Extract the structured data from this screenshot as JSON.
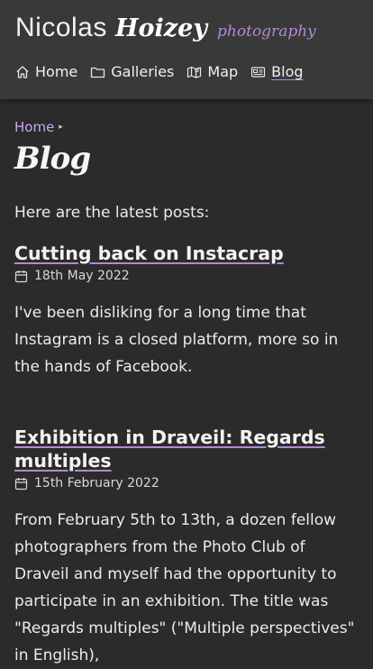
{
  "site": {
    "first_name": "Nicolas",
    "last_name": "Hoizey",
    "subtitle": "photography"
  },
  "nav": {
    "items": [
      {
        "label": "Home",
        "icon": "home-icon"
      },
      {
        "label": "Galleries",
        "icon": "folder-icon"
      },
      {
        "label": "Map",
        "icon": "map-icon"
      },
      {
        "label": "Blog",
        "icon": "blog-card-icon",
        "active": true
      }
    ]
  },
  "breadcrumb": {
    "home_label": "Home",
    "separator": "▸"
  },
  "page": {
    "title": "Blog",
    "intro": "Here are the latest posts:"
  },
  "posts": [
    {
      "title": "Cutting back on Instacrap",
      "date": "18th May 2022",
      "excerpt": "I've been disliking for a long time that Instagram is a closed platform, more so in the hands of Facebook."
    },
    {
      "title": "Exhibition in Draveil: Regards multiples",
      "date": "15th February 2022",
      "excerpt": "From February 5th to 13th, a dozen fellow photographers from the Photo Club of Draveil and myself had the opportunity to participate in an exhibition. The title was \"Regards multiples\" (\"Multiple perspectives\" in English),"
    }
  ],
  "colors": {
    "background": "#2b2b2b",
    "header": "#393939",
    "accent": "#b08ad8",
    "link": "#c9a8ef"
  }
}
